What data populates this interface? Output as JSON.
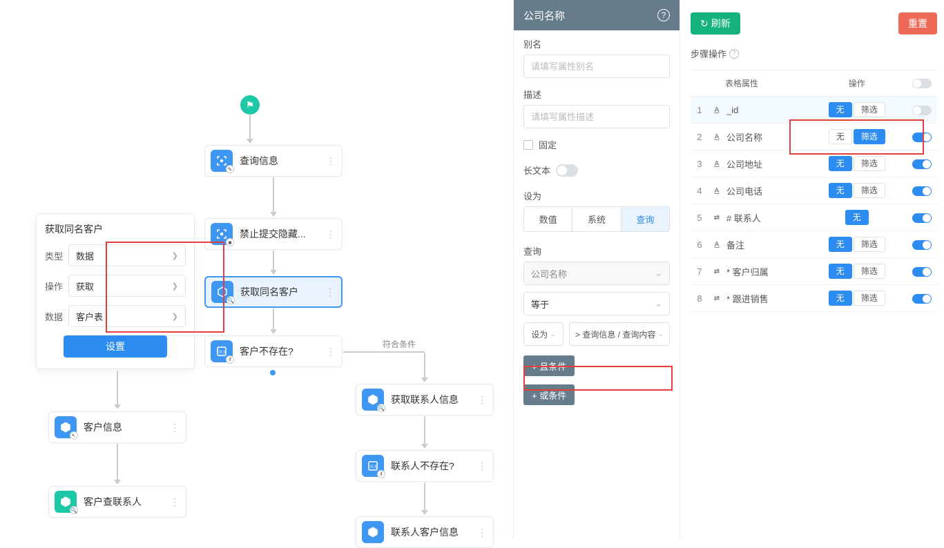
{
  "canvas": {
    "flag": "⚑",
    "nodes": {
      "n1": "查询信息",
      "n2": "禁止提交隐藏...",
      "n3": "获取同名客户",
      "n4": "客户不存在?",
      "n5": "获取联系人信息",
      "n6": "联系人不存在?",
      "n7": "联系人客户信息",
      "n8": "客户信息",
      "n9": "客户查联系人"
    },
    "cond_label": "符合条件"
  },
  "popover": {
    "title": "获取同名客户",
    "rows": {
      "type_lbl": "类型",
      "type_val": "数据",
      "op_lbl": "操作",
      "op_val": "获取",
      "data_lbl": "数据",
      "data_val": "客户表"
    },
    "setbtn": "设置"
  },
  "mid": {
    "header": "公司名称",
    "alias_lbl": "别名",
    "alias_ph": "请填写属性别名",
    "desc_lbl": "描述",
    "desc_ph": "请填写属性描述",
    "fix_lbl": "固定",
    "longtext_lbl": "长文本",
    "setas_lbl": "设为",
    "tabs": {
      "num": "数值",
      "sys": "系统",
      "query": "查询"
    },
    "query_lbl": "查询",
    "qfield": "公司名称",
    "qop": "等于",
    "qset": "设为",
    "qval": "> 查询信息 / 查询内容",
    "and_btn": "+ 且条件",
    "or_btn": "+ 或条件"
  },
  "right": {
    "refresh": "刷新",
    "reset": "重置",
    "section": "步骤操作",
    "th_attr": "表格属性",
    "th_op": "操作",
    "rows": [
      {
        "n": "1",
        "icon": "A",
        "name": "_id",
        "pills": [
          "无",
          "筛选"
        ],
        "active": 0,
        "toggle": false,
        "selected": true
      },
      {
        "n": "2",
        "icon": "A",
        "name": "公司名称",
        "pills": [
          "无",
          "筛选"
        ],
        "active": 1,
        "toggle": true,
        "highlight": true
      },
      {
        "n": "3",
        "icon": "A",
        "name": "公司地址",
        "pills": [
          "无",
          "筛选"
        ],
        "active": 0,
        "toggle": true
      },
      {
        "n": "4",
        "icon": "A",
        "name": "公司电话",
        "pills": [
          "无",
          "筛选"
        ],
        "active": 0,
        "toggle": true
      },
      {
        "n": "5",
        "icon": "link",
        "name": "# 联系人",
        "pills": [
          "无"
        ],
        "active": 0,
        "toggle": true
      },
      {
        "n": "6",
        "icon": "A",
        "name": "备注",
        "pills": [
          "无",
          "筛选"
        ],
        "active": 0,
        "toggle": true
      },
      {
        "n": "7",
        "icon": "link",
        "name": "* 客户归属",
        "pills": [
          "无",
          "筛选"
        ],
        "active": 0,
        "toggle": true
      },
      {
        "n": "8",
        "icon": "link",
        "name": "* 跟进销售",
        "pills": [
          "无",
          "筛选"
        ],
        "active": 0,
        "toggle": true
      }
    ]
  }
}
